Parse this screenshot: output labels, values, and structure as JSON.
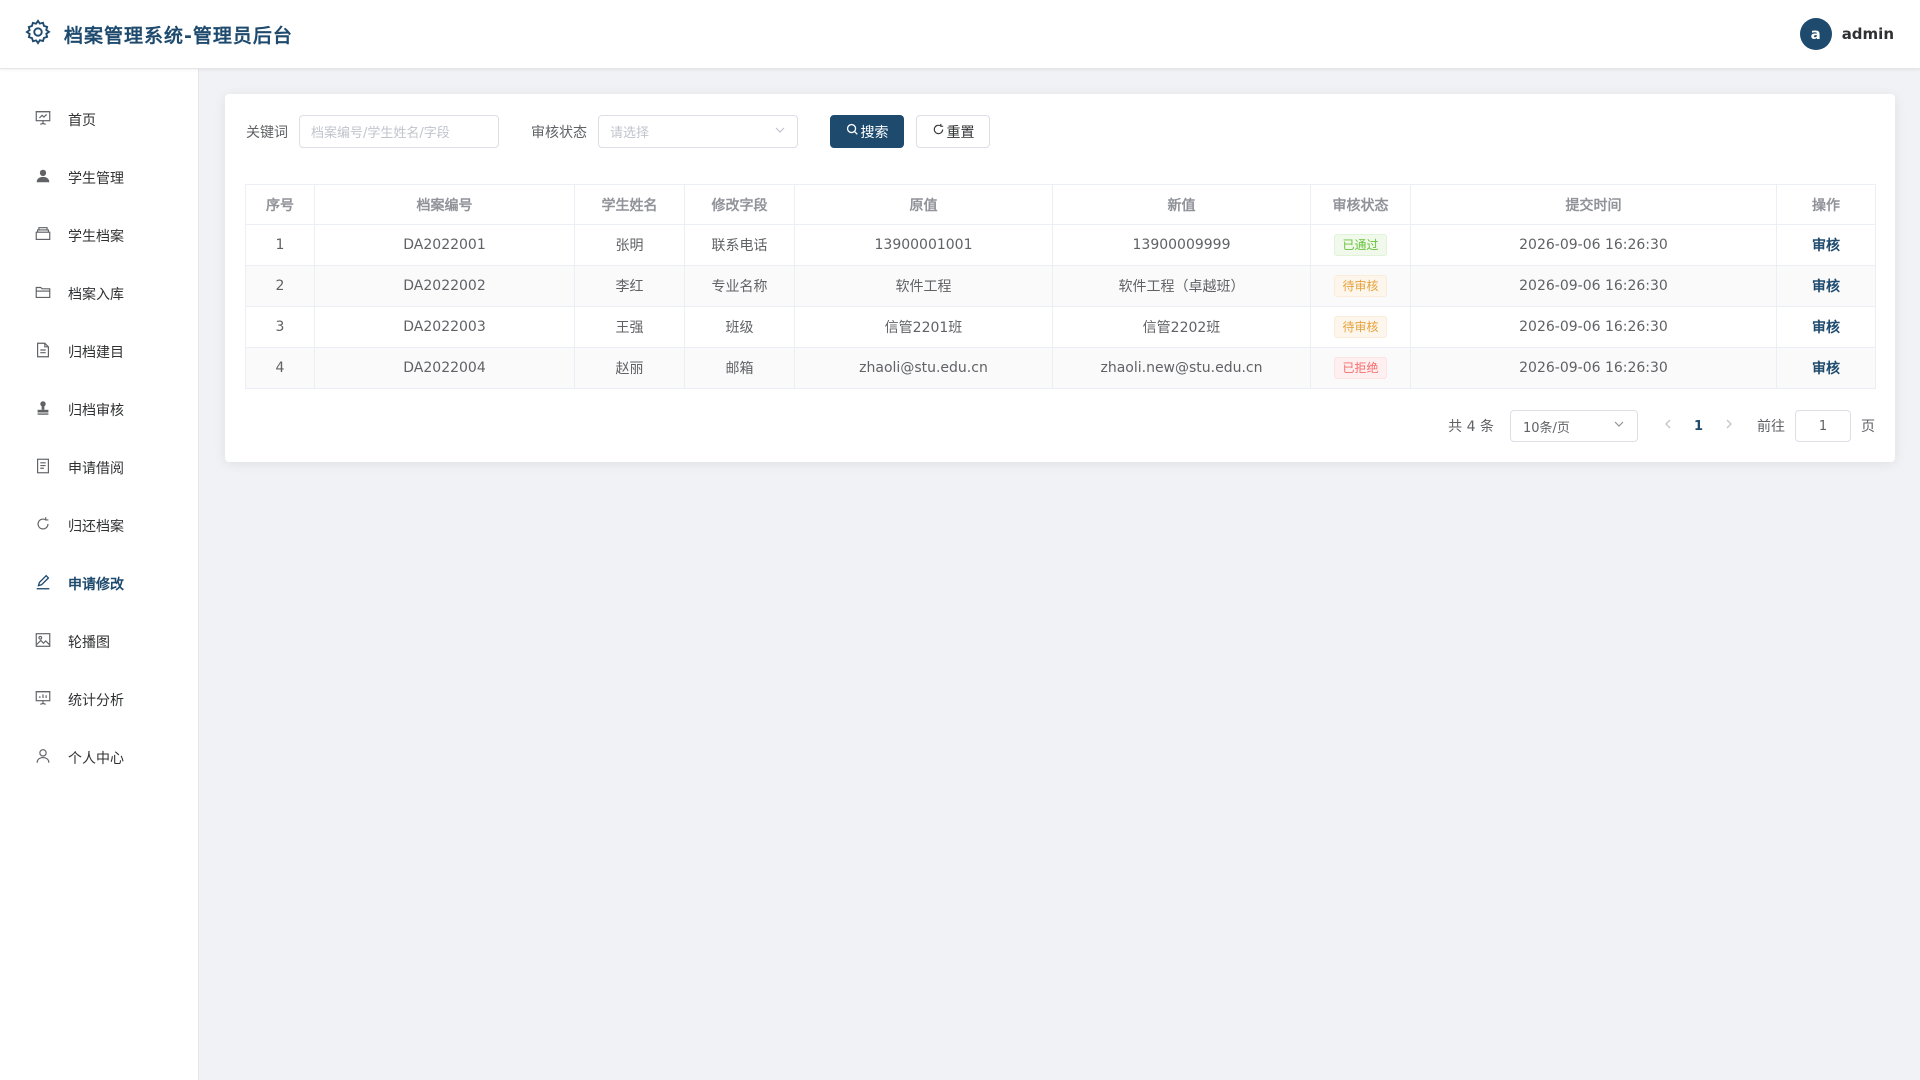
{
  "header": {
    "title": "档案管理系统-管理员后台",
    "avatar_letter": "a",
    "username": "admin",
    "accent_color": "#1e4a6e"
  },
  "sidebar": {
    "items": [
      {
        "label": "首页",
        "icon": "presentation-board-icon"
      },
      {
        "label": "学生管理",
        "icon": "user-filled-icon"
      },
      {
        "label": "学生档案",
        "icon": "files-box-icon"
      },
      {
        "label": "档案入库",
        "icon": "folder-open-icon"
      },
      {
        "label": "归档建目",
        "icon": "document-icon"
      },
      {
        "label": "归档审核",
        "icon": "stamp-icon"
      },
      {
        "label": "申请借阅",
        "icon": "tickets-icon"
      },
      {
        "label": "归还档案",
        "icon": "refresh-icon"
      },
      {
        "label": "申请修改",
        "icon": "edit-pen-icon",
        "active": true
      },
      {
        "label": "轮播图",
        "icon": "picture-icon"
      },
      {
        "label": "统计分析",
        "icon": "data-board-icon"
      },
      {
        "label": "个人中心",
        "icon": "user-outline-icon"
      }
    ]
  },
  "filters": {
    "keyword_label": "关键词",
    "keyword_placeholder": "档案编号/学生姓名/字段",
    "status_label": "审核状态",
    "status_placeholder": "请选择",
    "search_label": "搜索",
    "reset_label": "重置"
  },
  "table": {
    "columns": [
      "序号",
      "档案编号",
      "学生姓名",
      "修改字段",
      "原值",
      "新值",
      "审核状态",
      "提交时间",
      "操作"
    ],
    "rows": [
      {
        "idx": "1",
        "archive_no": "DA2022001",
        "name": "张明",
        "field": "联系电话",
        "old": "13900001001",
        "new": "13900009999",
        "status": "已通过",
        "status_type": "pass",
        "time": "2026-09-06 16:26:30",
        "action": "审核"
      },
      {
        "idx": "2",
        "archive_no": "DA2022002",
        "name": "李红",
        "field": "专业名称",
        "old": "软件工程",
        "new": "软件工程（卓越班）",
        "status": "待审核",
        "status_type": "pending",
        "time": "2026-09-06 16:26:30",
        "action": "审核"
      },
      {
        "idx": "3",
        "archive_no": "DA2022003",
        "name": "王强",
        "field": "班级",
        "old": "信管2201班",
        "new": "信管2202班",
        "status": "待审核",
        "status_type": "pending",
        "time": "2026-09-06 16:26:30",
        "action": "审核"
      },
      {
        "idx": "4",
        "archive_no": "DA2022004",
        "name": "赵丽",
        "field": "邮箱",
        "old": "zhaoli@stu.edu.cn",
        "new": "zhaoli.new@stu.edu.cn",
        "status": "已拒绝",
        "status_type": "reject",
        "time": "2026-09-06 16:26:30",
        "action": "审核"
      }
    ]
  },
  "pagination": {
    "total_text": "共 4 条",
    "page_size": "10条/页",
    "current_page": "1",
    "goto_label": "前往",
    "goto_value": "1",
    "page_suffix": "页"
  }
}
